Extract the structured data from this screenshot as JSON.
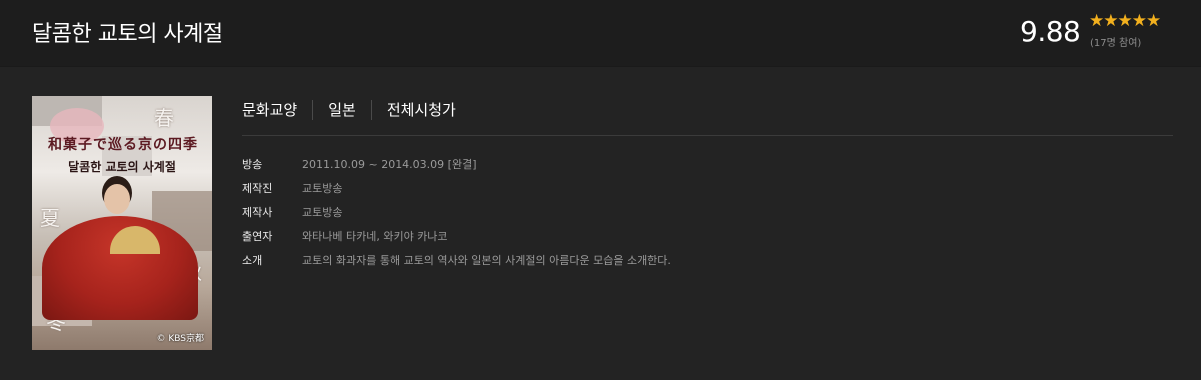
{
  "header": {
    "title": "달콤한 교토의 사계절",
    "rating": "9.88",
    "stars": "★★★★★",
    "participants": "(17명 참여)"
  },
  "poster": {
    "calligraphy": "和菓子で巡る京の四季",
    "subtitle": "달콤한 교토의 사계절",
    "seasons": [
      "春",
      "夏",
      "秋",
      "冬"
    ],
    "copyright": "© KBS京都"
  },
  "categories": [
    "문화교양",
    "일본",
    "전체시청가"
  ],
  "info": [
    {
      "label": "방송",
      "value": "2011.10.09 ~ 2014.03.09 [완결]"
    },
    {
      "label": "제작진",
      "value": "교토방송"
    },
    {
      "label": "제작사",
      "value": "교토방송"
    },
    {
      "label": "출연자",
      "value": "와타나베 타카네, 와키야 카나코"
    },
    {
      "label": "소개",
      "value": "교토의 화과자를 통해 교토의 역사와 일본의 사계절의 아름다운 모습을 소개한다."
    }
  ],
  "colors": {
    "background": "#232323",
    "header_background": "#1d1d1d",
    "star": "#f2b01e"
  }
}
